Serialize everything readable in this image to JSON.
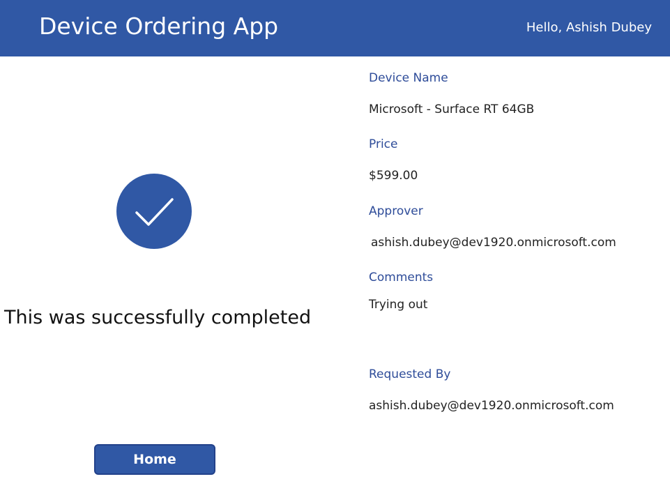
{
  "header": {
    "title": "Device Ordering App",
    "greeting": "Hello, Ashish Dubey"
  },
  "status": {
    "icon": "checkmark-circle-icon",
    "message": "This was successfully completed"
  },
  "home_button": {
    "label": "Home"
  },
  "details": {
    "device_name": {
      "label": "Device Name",
      "value": "Microsoft - Surface RT 64GB"
    },
    "price": {
      "label": "Price",
      "value": "$599.00"
    },
    "approver": {
      "label": "Approver",
      "value": "ashish.dubey@dev1920.onmicrosoft.com"
    },
    "comments": {
      "label": "Comments",
      "value": "Trying out"
    },
    "requested_by": {
      "label": "Requested By",
      "value": "ashish.dubey@dev1920.onmicrosoft.com"
    }
  },
  "colors": {
    "brand": "#3058a5",
    "label": "#2e4c99",
    "text": "#222222"
  }
}
